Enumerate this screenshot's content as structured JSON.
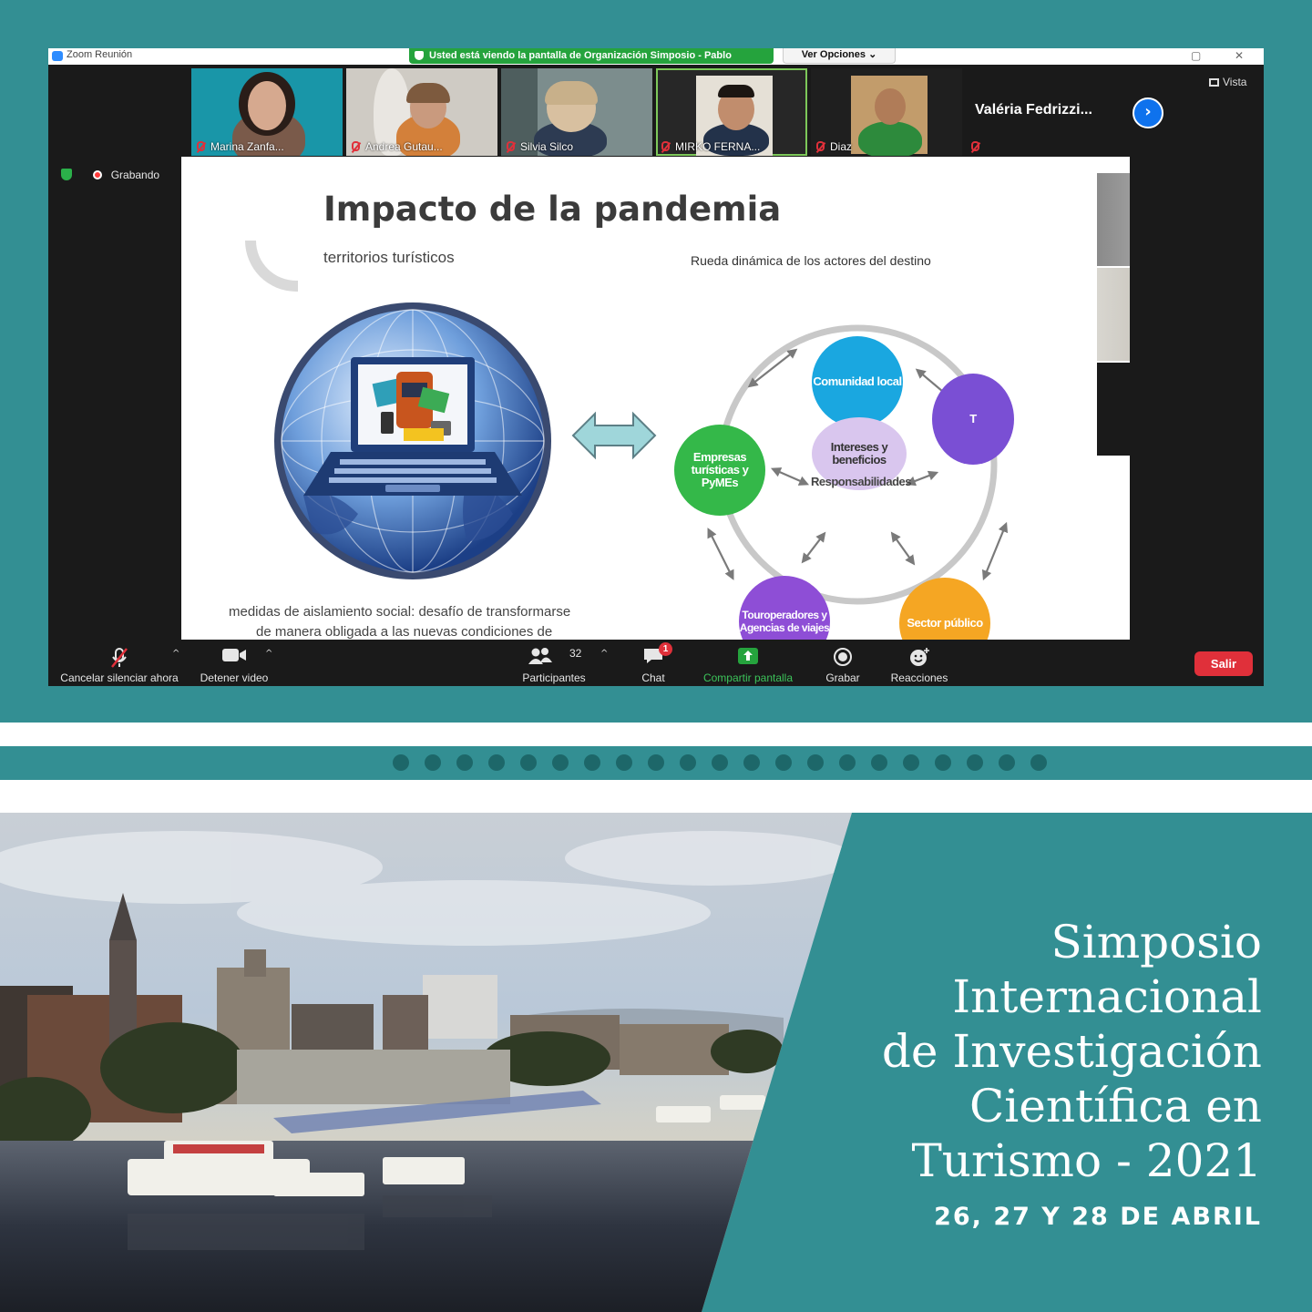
{
  "window": {
    "app_title": "Zoom Reunión",
    "share_banner": "Usted está viendo la pantalla de Organización Simposio - Pablo",
    "view_options": "Ver Opciones ⌄",
    "minimize": "▢",
    "close": "✕"
  },
  "participants_strip": [
    {
      "name": "Marina Zanfa..."
    },
    {
      "name": "Andrea Gutau..."
    },
    {
      "name": "Silvia Silco"
    },
    {
      "name": "MIRKO FERNA..."
    },
    {
      "name": "Diaz"
    },
    {
      "name": "Valéria  Fedrizzi..."
    }
  ],
  "view_button": "Vista",
  "next_arrow": "›",
  "recording_label": "Grabando",
  "slide": {
    "title": "Impacto de la pandemia",
    "subtitle": "territorios turísticos",
    "wheel_title": "Rueda dinámica de los actores del destino",
    "caption_line1": "medidas de aislamiento social: desafío de transformarse",
    "caption_line2": "de manera obligada a las nuevas condiciones de",
    "nodes": {
      "comunidad": "Comunidad local",
      "empresas": "Empresas turísticas y PyMEs",
      "center": "Intereses y beneficios",
      "center_sub": "Responsabilidades",
      "touroperadores": "Touroperadores y Agencias de viajes",
      "sector": "Sector público",
      "partial": "T"
    },
    "colors": {
      "comunidad": "#1aa7e0",
      "empresas": "#34b849",
      "center": "#d9c6ee",
      "touroperadores": "#8e4ed6",
      "sector": "#f5a623",
      "partial": "#7a4fd4"
    }
  },
  "toolbar": {
    "mute": "Cancelar silenciar ahora",
    "video": "Detener video",
    "participants_count": "32",
    "participants": "Participantes",
    "chat": "Chat",
    "chat_badge": "1",
    "share": "Compartir pantalla",
    "record": "Grabar",
    "reactions": "Reacciones",
    "leave": "Salir"
  },
  "event": {
    "title_lines": [
      "Simposio",
      "Internacional ",
      "de Investigación",
      "Científica en",
      "Turismo - 2021"
    ],
    "date": "26, 27 Y 28 DE ABRIL"
  },
  "colors": {
    "teal": "#338f93",
    "dot": "#1d6769",
    "zoom_bg": "#1a1a1a",
    "share_green": "#25a33d",
    "leave_red": "#e0303a"
  }
}
